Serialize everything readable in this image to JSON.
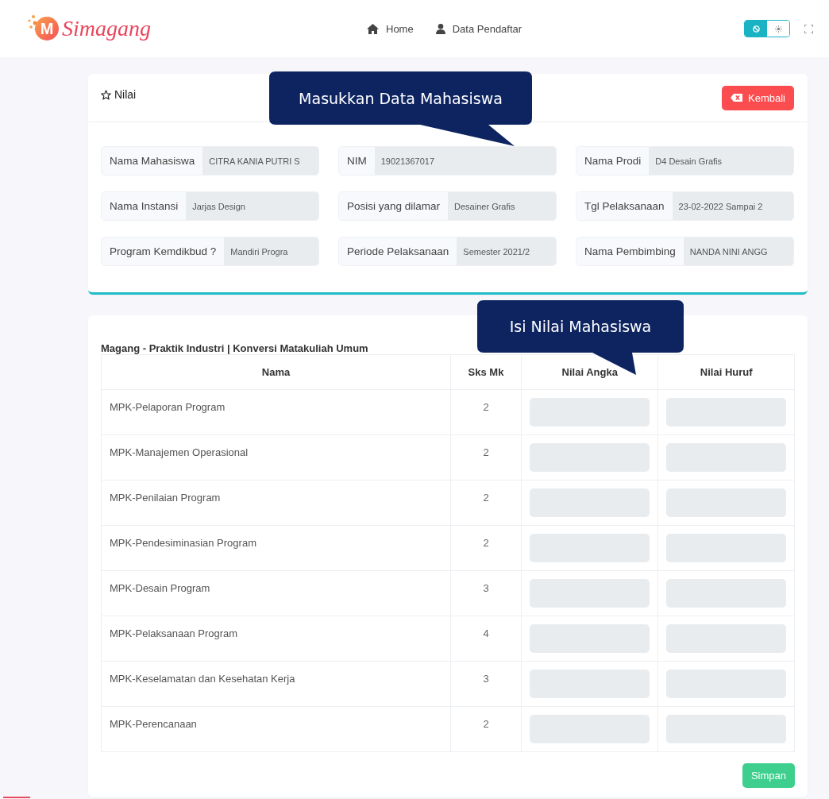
{
  "brand": {
    "mark": "M",
    "name": "Simagang"
  },
  "nav": [
    {
      "label": "Home",
      "kind": "home"
    },
    {
      "label": "Data Pendaftar",
      "kind": "user"
    }
  ],
  "theme_toggle": [
    {
      "kind": "dark",
      "selected": true
    },
    {
      "kind": "light",
      "selected": false
    }
  ],
  "info_card": {
    "title": "Nilai",
    "back_button": "Kembali",
    "fields": [
      {
        "label": "Nama Mahasiswa",
        "value": "CITRA KANIA PUTRI S"
      },
      {
        "label": "NIM",
        "value": "19021367017"
      },
      {
        "label": "Nama Prodi",
        "value": "D4 Desain Grafis"
      },
      {
        "label": "Nama Instansi",
        "value": "Jarjas Design"
      },
      {
        "label": "Posisi yang dilamar",
        "value": "Desainer Grafis"
      },
      {
        "label": "Tgl Pelaksanaan",
        "value": "23-02-2022 Sampai 2"
      },
      {
        "label": "Program Kemdikbud ?",
        "value": "Mandiri Progra"
      },
      {
        "label": "Periode Pelaksanaan",
        "value": "Semester 2021/2"
      },
      {
        "label": "Nama Pembimbing",
        "value": "NANDA NINI ANGG"
      }
    ]
  },
  "grades_card": {
    "title": "Magang - Praktik Industri | Konversi Matakuliah Umum",
    "columns": [
      "Nama",
      "Sks Mk",
      "Nilai Angka",
      "Nilai Huruf"
    ],
    "rows": [
      {
        "name": "MPK-Pelaporan Program",
        "sks": "2"
      },
      {
        "name": "MPK-Manajemen Operasional",
        "sks": "2"
      },
      {
        "name": "MPK-Penilaian Program",
        "sks": "2"
      },
      {
        "name": "MPK-Pendesiminasian Program",
        "sks": "2"
      },
      {
        "name": "MPK-Desain Program",
        "sks": "3"
      },
      {
        "name": "MPK-Pelaksanaan Program",
        "sks": "4"
      },
      {
        "name": "MPK-Keselamatan dan Kesehatan Kerja",
        "sks": "3"
      },
      {
        "name": "MPK-Perencanaan",
        "sks": "2"
      }
    ],
    "save_button": "Simpan"
  },
  "callouts": [
    {
      "text": "Masukkan Data Mahasiswa"
    },
    {
      "text": "Isi Nilai Mahasiswa"
    }
  ]
}
